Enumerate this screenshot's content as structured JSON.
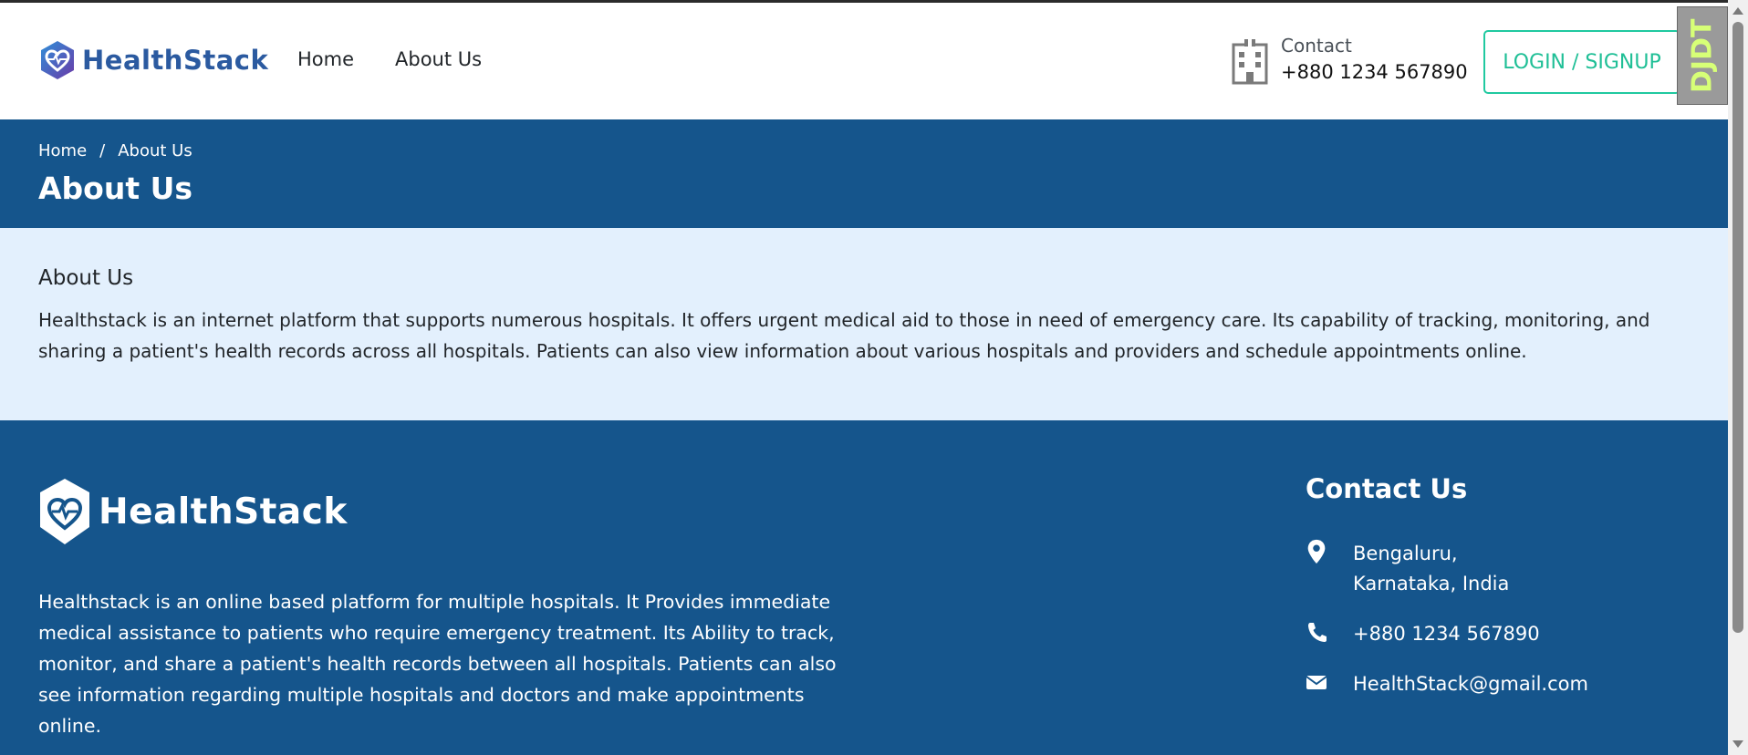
{
  "header": {
    "brand": "HealthStack",
    "nav": [
      {
        "label": "Home"
      },
      {
        "label": "About Us"
      }
    ],
    "contact_label": "Contact",
    "contact_phone": "+880 1234 567890",
    "login_label": "LOGIN / SIGNUP",
    "debug_toolbar_label": "DJDT"
  },
  "banner": {
    "breadcrumb": {
      "home": "Home",
      "separator": "/",
      "current": "About Us"
    },
    "title": "About Us"
  },
  "about": {
    "heading": "About Us",
    "text": "Healthstack is an internet platform that supports numerous hospitals. It offers urgent medical aid to those in need of emergency care. Its capability of tracking, monitoring, and sharing a patient's health records across all hospitals. Patients can also view information about various hospitals and providers and schedule appointments online."
  },
  "footer": {
    "brand": "HealthStack",
    "description": "Healthstack is an online based platform for multiple hospitals. It Provides immediate medical assistance to patients who require emergency treatment. Its Ability to track, monitor, and share a patient's health records between all hospitals. Patients can also see information regarding multiple hospitals and doctors and make appointments online.",
    "contact": {
      "heading": "Contact Us",
      "address_line1": "Bengaluru,",
      "address_line2": "Karnataka, India",
      "phone": "+880 1234 567890",
      "email": "HealthStack@gmail.com"
    }
  },
  "colors": {
    "primary": "#15558c",
    "light_bg": "#e3f0fd",
    "accent": "#20c9a0",
    "brand_text": "#2b5aa0"
  },
  "icons": [
    "logo-heart-icon",
    "hospital-building-icon",
    "map-marker-icon",
    "phone-icon",
    "envelope-icon"
  ]
}
